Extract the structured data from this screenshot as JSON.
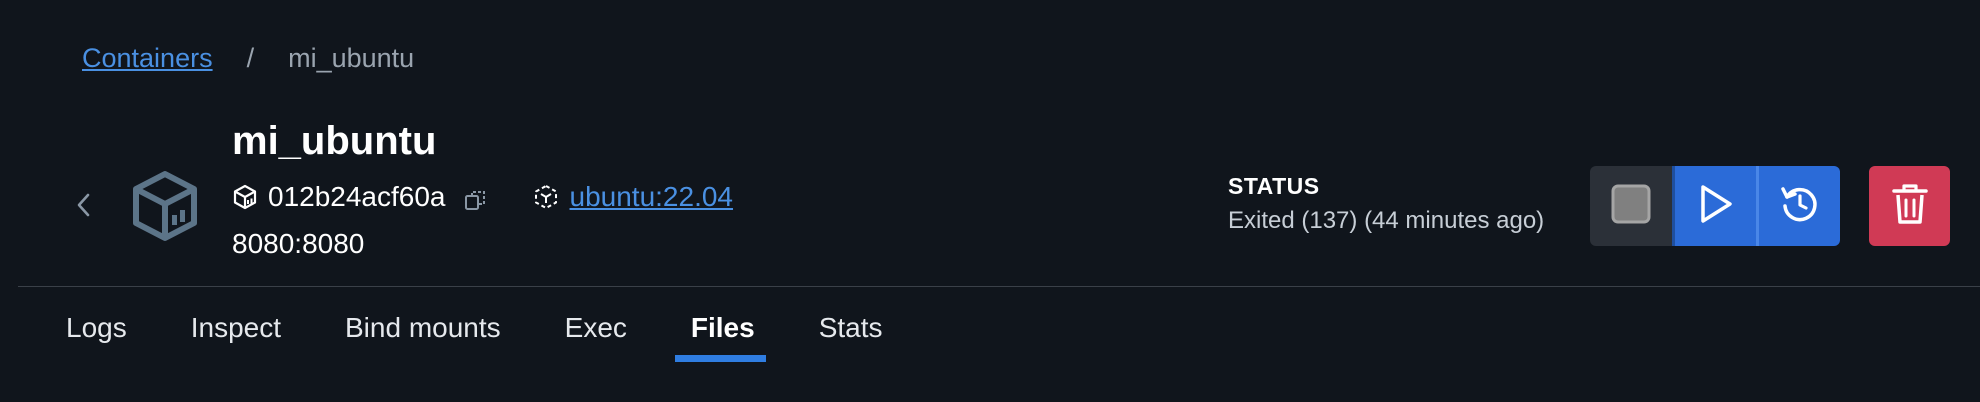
{
  "breadcrumb": {
    "parent": "Containers",
    "separator": "/",
    "current": "mi_ubuntu"
  },
  "container": {
    "name": "mi_ubuntu",
    "id": "012b24acf60a",
    "image": "ubuntu:22.04",
    "ports": "8080:8080"
  },
  "status": {
    "label": "STATUS",
    "text": "Exited (137) (44 minutes ago)"
  },
  "tabs": [
    {
      "label": "Logs"
    },
    {
      "label": "Inspect"
    },
    {
      "label": "Bind mounts"
    },
    {
      "label": "Exec"
    },
    {
      "label": "Files",
      "active": true
    },
    {
      "label": "Stats"
    }
  ],
  "icons": {
    "back": "chevron-left-icon",
    "container": "container-box-icon",
    "id": "cube-icon",
    "copy": "copy-icon",
    "image": "image-icon",
    "stop": "stop-icon",
    "start": "play-icon",
    "restart": "restart-icon",
    "delete": "trash-icon"
  },
  "colors": {
    "background": "#10151c",
    "link": "#4a90e2",
    "primary_button": "#2b6bd8",
    "danger_button": "#d03a55",
    "tab_indicator": "#2f7de1"
  }
}
